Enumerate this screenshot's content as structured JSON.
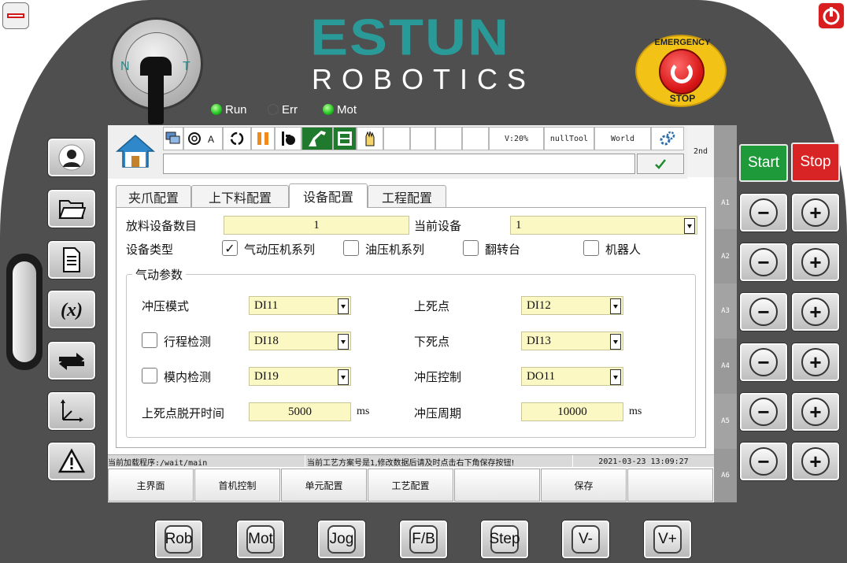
{
  "brand": {
    "name": "ESTUN",
    "subtitle": "ROBOTICS"
  },
  "mode_switch": {
    "left_label": "N",
    "right_label": "T"
  },
  "indicators": [
    {
      "label": "Run",
      "on": true
    },
    {
      "label": "Err",
      "on": false
    },
    {
      "label": "Mot",
      "on": true
    }
  ],
  "emergency_stop": {
    "top_text": "EMERGENCY",
    "bottom_text": "STOP"
  },
  "toolbar": {
    "speed": "V:20%",
    "tool": "nullTool",
    "coord": "World",
    "second": "2nd",
    "command_value": ""
  },
  "side_sections": [
    "A1",
    "A2",
    "A3",
    "A4",
    "A5",
    "A6"
  ],
  "tabs": [
    {
      "label": "夹爪配置",
      "active": false
    },
    {
      "label": "上下料配置",
      "active": false
    },
    {
      "label": "设备配置",
      "active": true
    },
    {
      "label": "工程配置",
      "active": false
    }
  ],
  "form": {
    "unload_count_label": "放料设备数目",
    "unload_count_value": "1",
    "current_device_label": "当前设备",
    "current_device_value": "1",
    "device_type_label": "设备类型",
    "device_types": [
      {
        "label": "气动压机系列",
        "checked": true
      },
      {
        "label": "油压机系列",
        "checked": false
      },
      {
        "label": "翻转台",
        "checked": false
      },
      {
        "label": "机器人",
        "checked": false
      }
    ],
    "group_title": "气动参数",
    "press_mode_label": "冲压模式",
    "press_mode_value": "DI11",
    "top_dead_label": "上死点",
    "top_dead_value": "DI12",
    "stroke_check_label": "行程检测",
    "stroke_check_checked": false,
    "stroke_check_value": "DI18",
    "bottom_dead_label": "下死点",
    "bottom_dead_value": "DI13",
    "die_check_label": "模内检测",
    "die_check_checked": false,
    "die_check_value": "DI19",
    "press_control_label": "冲压控制",
    "press_control_value": "DO11",
    "release_time_label": "上死点脱开时间",
    "release_time_value": "5000",
    "release_time_unit": "ms",
    "press_period_label": "冲压周期",
    "press_period_value": "10000",
    "press_period_unit": "ms"
  },
  "status": {
    "program": "当前加载程序:/wait/main",
    "message": "当前工艺方案号是1,修改数据后请及时点击右下角保存按钮!",
    "datetime": "2021-03-23 13:09:27"
  },
  "bottom_nav": [
    "主界面",
    "首机控制",
    "单元配置",
    "工艺配置",
    "",
    "保存",
    ""
  ],
  "run_buttons": {
    "start": "Start",
    "stop": "Stop"
  },
  "function_keys": [
    "Rob",
    "Mot",
    "Jog",
    "F/B",
    "Step",
    "V-",
    "V+"
  ],
  "colors": {
    "brand": "#2a9a98",
    "start": "#1f9a3a",
    "stop": "#d82424",
    "field": "#fbf8c4",
    "estop": "#f2c316"
  }
}
